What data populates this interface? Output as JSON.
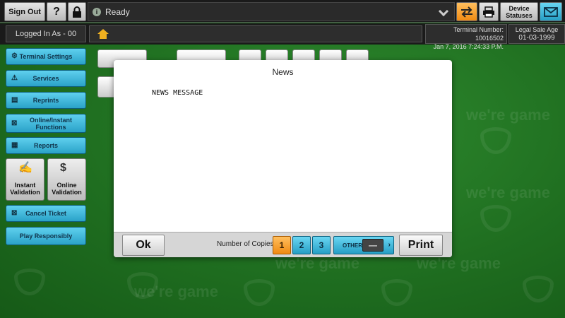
{
  "topbar": {
    "sign_out_label": "Sign Out",
    "help_label": "?",
    "status_text": "Ready",
    "device_statuses_label": "Device Statuses"
  },
  "header": {
    "logged_in_label": "Logged In As - 00",
    "terminal_number": "Terminal Number: 10016502",
    "datetime": "Jan 7, 2016 7:24:33 P.M.",
    "legal_age_label": "Legal Sale Age",
    "legal_age_date": "01-03-1999"
  },
  "sidebar": {
    "items": [
      {
        "label": "Terminal Settings",
        "icon": "gear-icon"
      },
      {
        "label": "Services",
        "icon": "warning-icon"
      },
      {
        "label": "Reprints",
        "icon": "ticket-icon"
      },
      {
        "label": "Online/Instant Functions",
        "icon": "function-icon"
      },
      {
        "label": "Reports",
        "icon": "report-icon"
      },
      {
        "label": "Cancel Ticket",
        "icon": "cancel-icon"
      },
      {
        "label": "Play Responsibly",
        "icon": ""
      }
    ],
    "instant_validation_label": "Instant Validation",
    "online_validation_label": "Online Validation"
  },
  "background": {
    "watermark_text": "we're game"
  },
  "modal": {
    "title": "News",
    "message": "NEWS MESSAGE",
    "ok_label": "Ok",
    "copies_label": "Number of Copies",
    "copy_options": [
      "1",
      "2",
      "3"
    ],
    "selected_copy": "1",
    "other_label": "OTHER",
    "other_value": "—",
    "print_label": "Print"
  },
  "colors": {
    "accent_blue": "#2aa2c8",
    "accent_orange": "#f08a12",
    "background_green": "#1f6e20"
  }
}
